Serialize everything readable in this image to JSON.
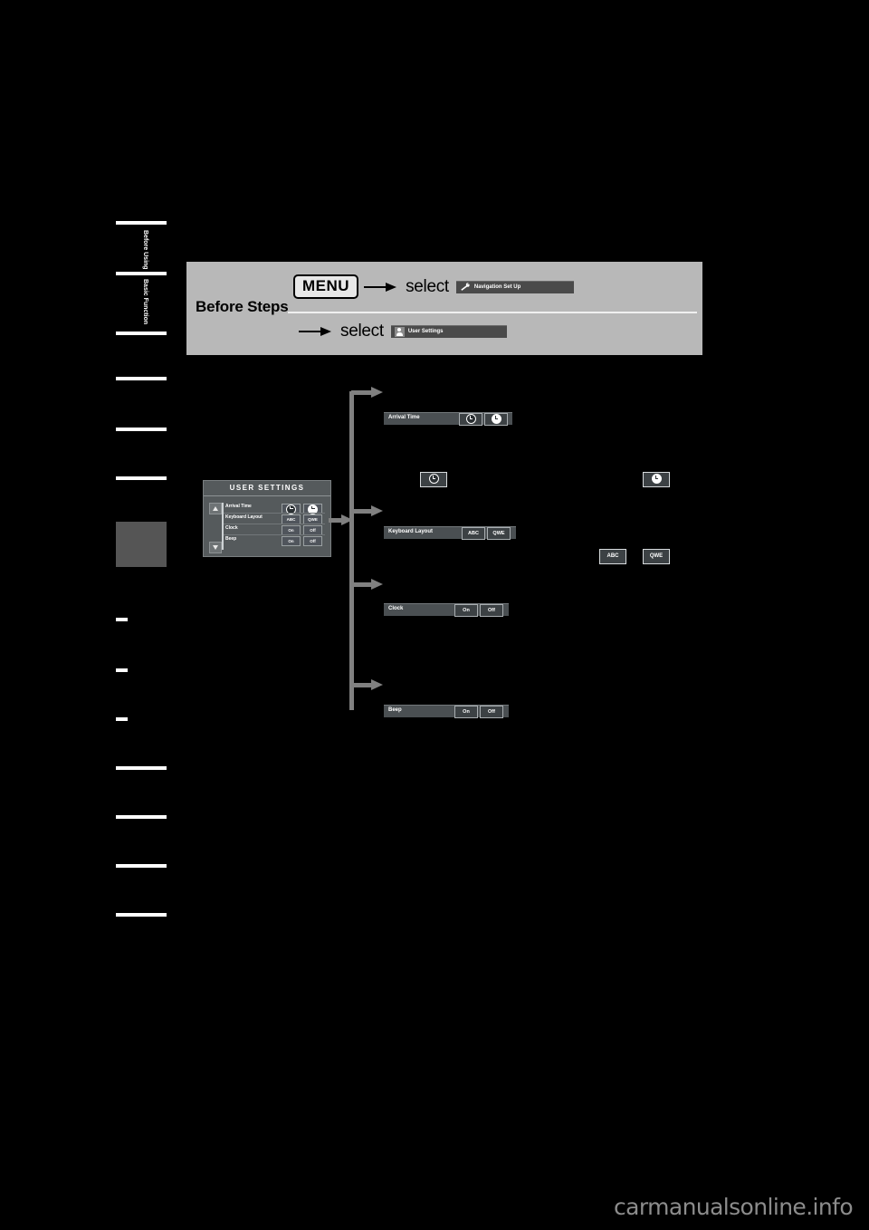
{
  "page": {
    "background": "#000000",
    "watermark": "carmanualsonline.info"
  },
  "sidebar": {
    "tabs": [
      {
        "label": "Before Using",
        "type": "rule-label"
      },
      {
        "label": "Basic Function",
        "type": "rule-label"
      },
      {
        "label": "",
        "type": "rule"
      },
      {
        "label": "",
        "type": "rule"
      },
      {
        "label": "",
        "type": "rule"
      },
      {
        "label": "",
        "type": "rule"
      },
      {
        "label": "",
        "type": "highlight"
      },
      {
        "label": "",
        "type": "rule-short"
      },
      {
        "label": "",
        "type": "rule-short"
      },
      {
        "label": "",
        "type": "rule-short"
      },
      {
        "label": "",
        "type": "rule"
      },
      {
        "label": "",
        "type": "rule"
      },
      {
        "label": "",
        "type": "rule"
      },
      {
        "label": "",
        "type": "rule"
      }
    ]
  },
  "before_steps": {
    "title": "Before Steps",
    "row1": {
      "key_label": "MENU",
      "select_label": "select",
      "pill_text": "Navigation Set Up",
      "pill_icon": "wrench-icon",
      "arrow": "arrow-right-icon"
    },
    "row2": {
      "select_label": "select",
      "pill_text": "User Settings",
      "pill_icon": "person-icon",
      "arrow": "arrow-right-icon"
    }
  },
  "user_settings_screen": {
    "title": "USER SETTINGS",
    "scroll_up_icon": "scroll-up-icon",
    "scroll_down_icon": "scroll-down-icon",
    "rows": [
      {
        "label": "Arrival Time",
        "btn1": "",
        "btn2": "",
        "btn1_icon": "clock-icon",
        "btn2_icon": "clock-filled-icon"
      },
      {
        "label": "Keyboard Layout",
        "btn1": "ABC",
        "btn2": "QWE"
      },
      {
        "label": "Clock",
        "btn1": "On",
        "btn2": "Off"
      },
      {
        "label": "Beep",
        "btn1": "On",
        "btn2": "Off"
      }
    ]
  },
  "detail_rows": [
    {
      "label": "Arrival Time",
      "btn1": "",
      "btn2": "",
      "btn1_icon": "clock-icon",
      "btn2_icon": "clock-filled-icon"
    },
    {
      "label": "Keyboard Layout",
      "btn1": "ABC",
      "btn2": "QWE"
    },
    {
      "label": "Clock",
      "btn1": "On",
      "btn2": "Off"
    },
    {
      "label": "Beep",
      "btn1": "On",
      "btn2": "Off"
    }
  ],
  "callout_buttons": {
    "arrival_left": {
      "label": "",
      "icon": "clock-icon"
    },
    "arrival_right": {
      "label": "",
      "icon": "clock-filled-icon"
    },
    "keyboard_abc": {
      "label": "ABC"
    },
    "keyboard_qwe": {
      "label": "QWE"
    }
  },
  "colors": {
    "page_bg": "#000000",
    "panel_bg": "#b8b8b8",
    "screen_bg": "#555a5c",
    "bar_bg": "#4a4f52",
    "arrow": "#808080",
    "text_light": "#ffffff",
    "text_dark": "#000000"
  }
}
